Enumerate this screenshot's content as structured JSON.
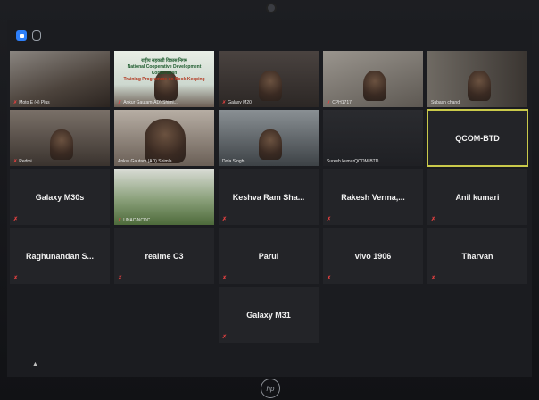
{
  "participants": [
    {
      "row": 0,
      "col": 0,
      "label": "Moto E (4) Plus",
      "name": "",
      "type": "video",
      "muted": true
    },
    {
      "row": 0,
      "col": 1,
      "label": "Ankur Gautam(AD) Shiml...",
      "name": "",
      "type": "video",
      "muted": true,
      "banner_text": [
        "राष्ट्रीय सहकारी विकास निगम",
        "National Cooperative Development Corporation",
        "Training Programme on Book Keeping"
      ]
    },
    {
      "row": 0,
      "col": 2,
      "label": "Galaxy M20",
      "name": "",
      "type": "video",
      "muted": true
    },
    {
      "row": 0,
      "col": 3,
      "label": "CPH1717",
      "name": "",
      "type": "video",
      "muted": true
    },
    {
      "row": 0,
      "col": 4,
      "label": "Subash chand",
      "name": "",
      "type": "video",
      "muted": false
    },
    {
      "row": 1,
      "col": 0,
      "label": "Redmi",
      "name": "",
      "type": "video",
      "muted": true
    },
    {
      "row": 1,
      "col": 1,
      "label": "Ankur Gautam (AD) Shimla",
      "name": "",
      "type": "video",
      "muted": false
    },
    {
      "row": 1,
      "col": 2,
      "label": "Dola Singh",
      "name": "",
      "type": "video",
      "muted": false
    },
    {
      "row": 1,
      "col": 3,
      "label": "Suresh kumarQCOM-BTD",
      "name": "",
      "type": "video",
      "muted": false
    },
    {
      "row": 1,
      "col": 4,
      "label": "",
      "name": "QCOM-BTD",
      "type": "name",
      "active": true,
      "muted": false
    },
    {
      "row": 2,
      "col": 0,
      "label": "",
      "name": "Galaxy M30s",
      "type": "name",
      "muted": true
    },
    {
      "row": 2,
      "col": 1,
      "label": "UNAC/NCDC",
      "name": "",
      "type": "video",
      "muted": true
    },
    {
      "row": 2,
      "col": 2,
      "label": "",
      "name": "Keshva Ram Sha...",
      "type": "name",
      "muted": true
    },
    {
      "row": 2,
      "col": 3,
      "label": "",
      "name": "Rakesh Verma,...",
      "type": "name",
      "muted": true
    },
    {
      "row": 2,
      "col": 4,
      "label": "",
      "name": "Anil kumari",
      "type": "name",
      "muted": true
    },
    {
      "row": 3,
      "col": 0,
      "label": "",
      "name": "Raghunandan S...",
      "type": "name",
      "muted": true
    },
    {
      "row": 3,
      "col": 1,
      "label": "",
      "name": "realme C3",
      "type": "name",
      "muted": true
    },
    {
      "row": 3,
      "col": 2,
      "label": "",
      "name": "Parul",
      "type": "name",
      "muted": true
    },
    {
      "row": 3,
      "col": 3,
      "label": "",
      "name": "vivo 1906",
      "type": "name",
      "muted": true
    },
    {
      "row": 3,
      "col": 4,
      "label": "",
      "name": "Tharvan",
      "type": "name",
      "muted": true
    },
    {
      "row": 4,
      "col": 2,
      "label": "",
      "name": "Galaxy M31",
      "type": "name",
      "muted": true
    }
  ],
  "brand": "hp",
  "colors": {
    "active_border": "#c9c94a",
    "mute": "#e04040",
    "tile": "#232428"
  }
}
